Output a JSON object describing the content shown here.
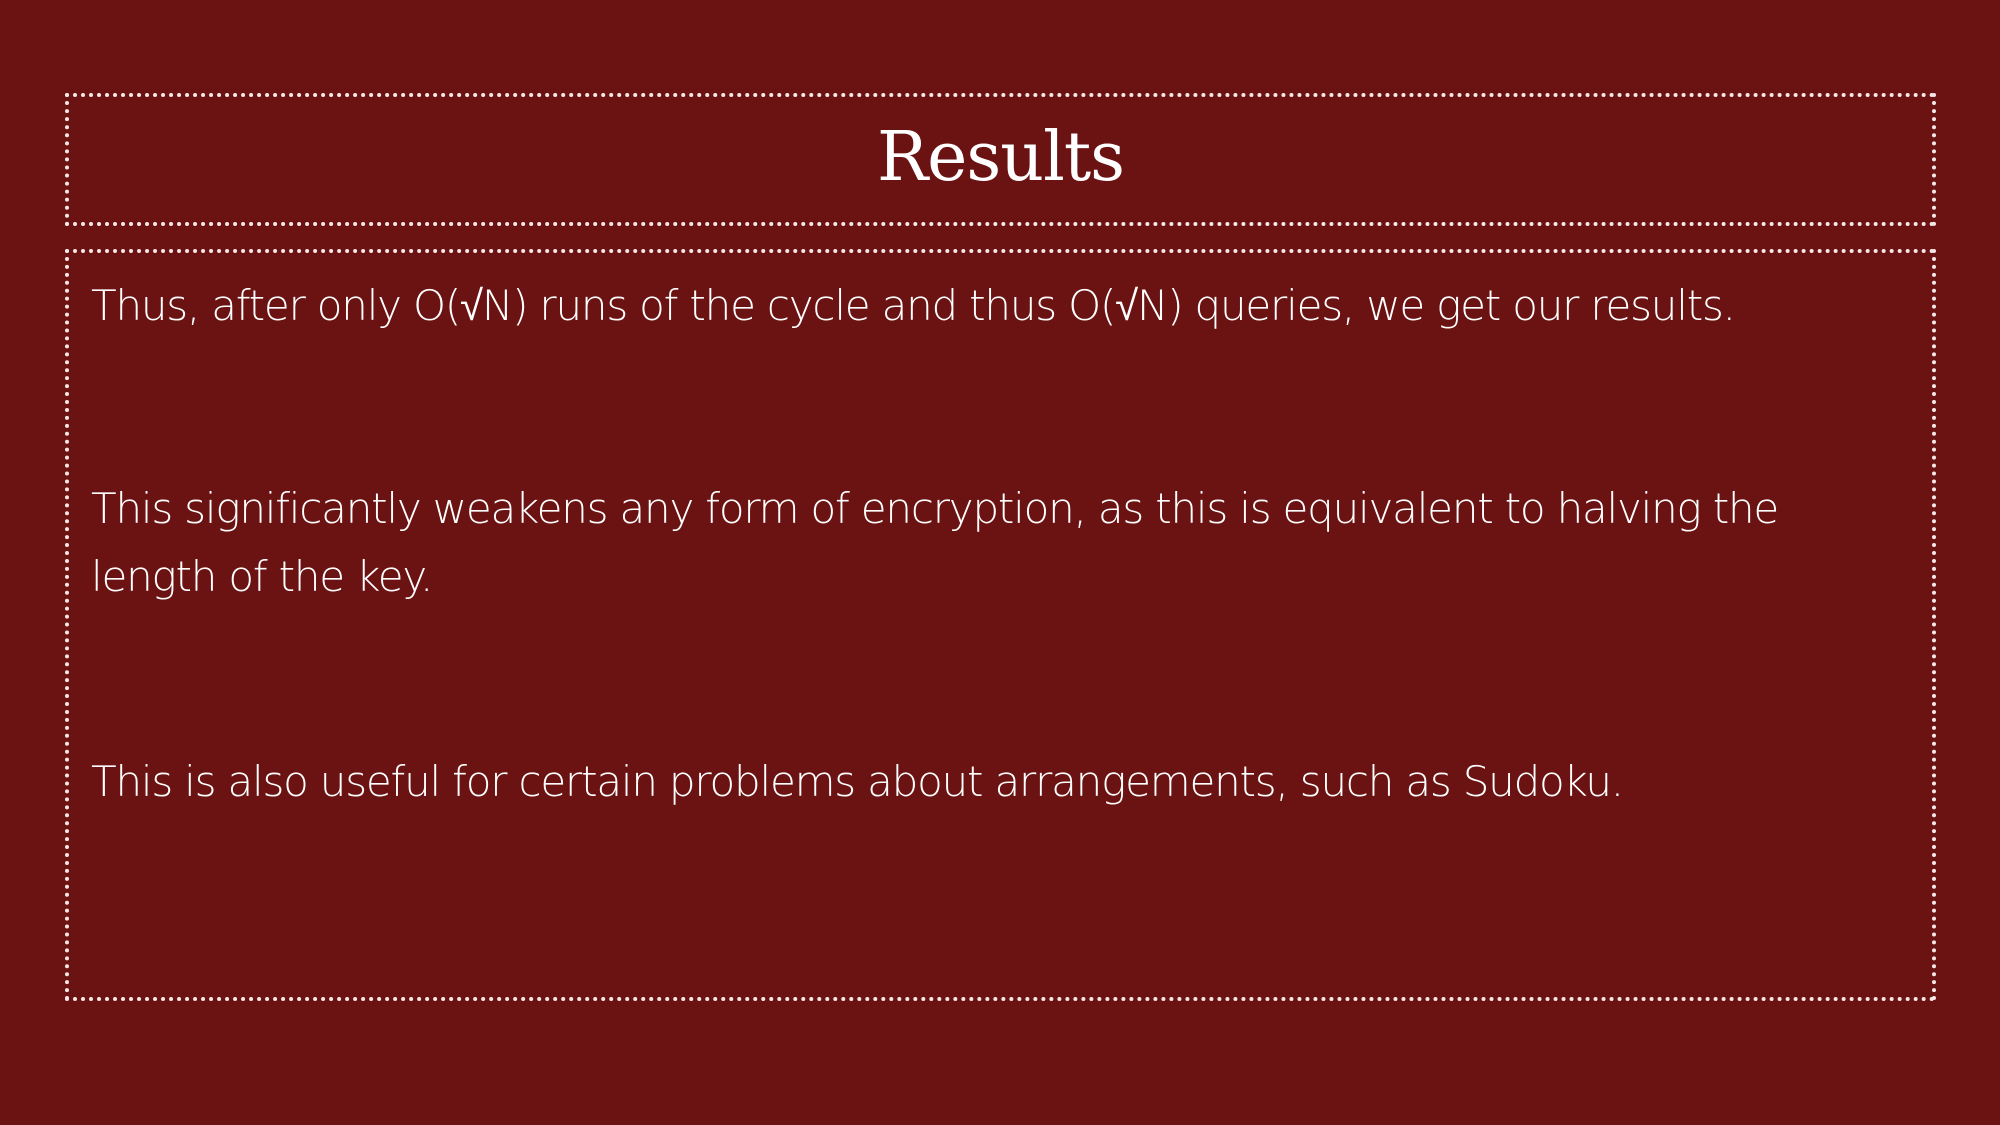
{
  "slide": {
    "title": "Results",
    "paragraphs": [
      "Thus, after only O(√N) runs of the cycle and thus O(√N) queries, we get our results.",
      "This significantly weakens any form of encryption, as this is equivalent to halving the length of the key.",
      "This is also useful for certain problems about arrangements, such as Sudoku."
    ]
  },
  "colors": {
    "background": "#6b1212",
    "text": "#ffffff",
    "border": "#f6e7e7"
  }
}
